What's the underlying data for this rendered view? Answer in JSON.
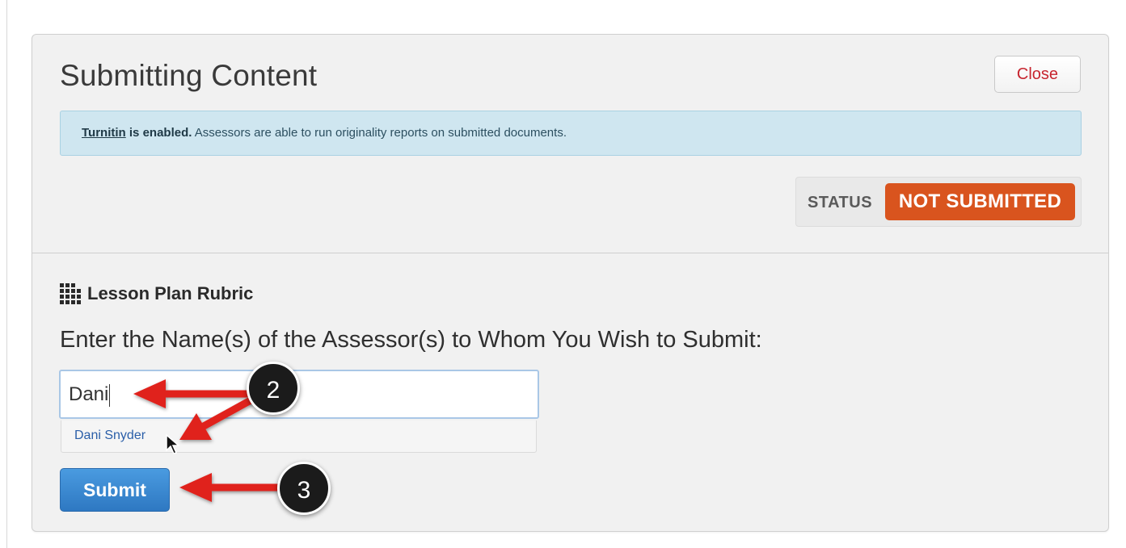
{
  "dialog": {
    "title": "Submitting Content",
    "close_label": "Close"
  },
  "alert": {
    "link_text": "Turnitin",
    "bold_text": " is enabled.",
    "message": " Assessors are able to run originality reports on submitted documents."
  },
  "status": {
    "label": "STATUS",
    "value": "NOT SUBMITTED",
    "badge_color": "#d9541e"
  },
  "rubric": {
    "icon": "grid-icon",
    "title": "Lesson Plan Rubric"
  },
  "form": {
    "prompt": "Enter the Name(s) of the Assessor(s) to Whom You Wish to Submit:",
    "assessor_value": "Dani",
    "suggestions": [
      "Dani Snyder"
    ],
    "submit_label": "Submit"
  },
  "annotations": {
    "step_2": "2",
    "step_3": "3",
    "arrow_color": "#e0211b"
  }
}
